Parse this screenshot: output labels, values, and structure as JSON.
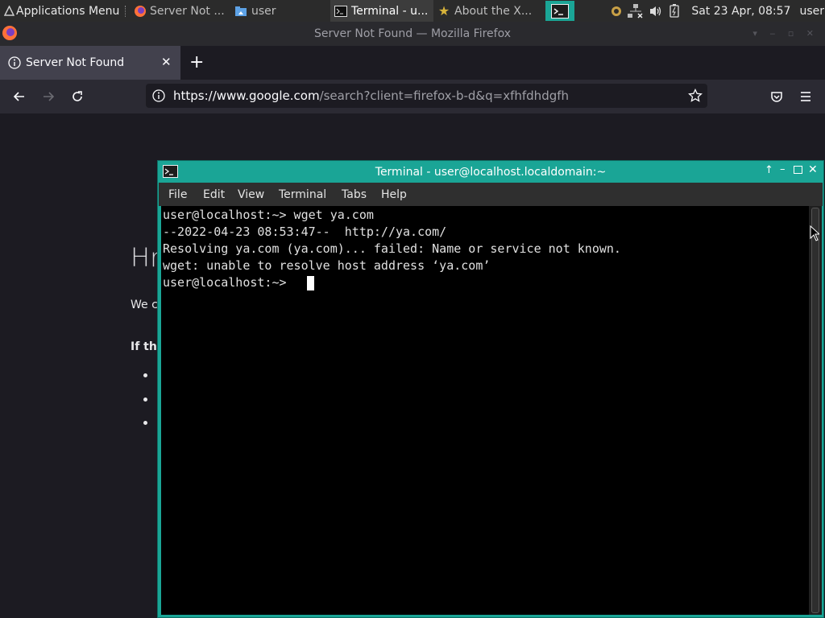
{
  "panel": {
    "apps_menu": "Applications Menu",
    "tasks": [
      {
        "label": "Server Not ...",
        "icon": "firefox-icon"
      },
      {
        "label": "user",
        "icon": "home-folder-icon"
      },
      {
        "label": "Terminal - u...",
        "icon": "terminal-icon",
        "active": true
      },
      {
        "label": "About the X...",
        "icon": "star-icon"
      }
    ],
    "clock": "Sat 23 Apr, 08:57",
    "user": "user"
  },
  "firefox": {
    "window_title": "Server Not Found — Mozilla Firefox",
    "tab_title": "Server Not Found",
    "url_host": "https://www.google.com",
    "url_path": "/search?client=firefox-b-d&q=xfhfdhdgfh",
    "page": {
      "heading_partial": "Hr",
      "para_partial": "We c",
      "bold_partial": "If th"
    }
  },
  "terminal": {
    "title": "Terminal - user@localhost.localdomain:~",
    "menu": [
      "File",
      "Edit",
      "View",
      "Terminal",
      "Tabs",
      "Help"
    ],
    "lines": [
      "user@localhost:~> wget ya.com",
      "--2022-04-23 08:53:47--  http://ya.com/",
      "Resolving ya.com (ya.com)... failed: Name or service not known.",
      "wget: unable to resolve host address ‘ya.com’",
      "user@localhost:~> "
    ]
  },
  "colors": {
    "terminal_accent": "#1aa596",
    "firefox_dark": "#1c1b22"
  }
}
